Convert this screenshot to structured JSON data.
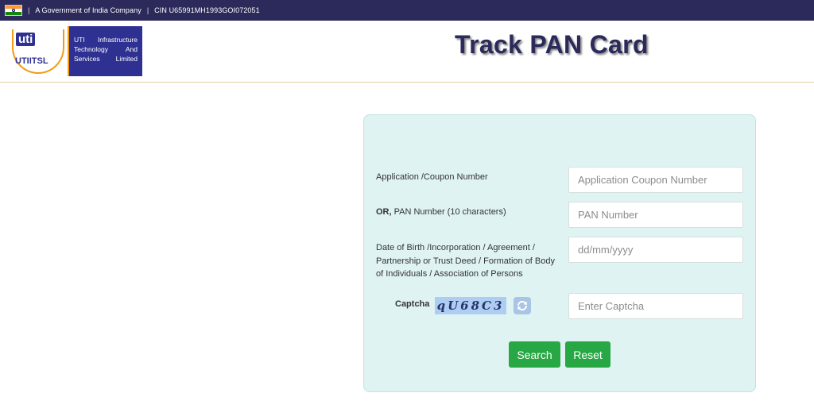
{
  "topbar": {
    "separator": "|",
    "company_note": "A Government of India Company",
    "cin": "CIN U65991MH1993GOI072051"
  },
  "header": {
    "logo": {
      "mark_text": "uti",
      "short_name": "UTIITSL",
      "full_name": "UTI Infrastructure Technology And Services Limited"
    },
    "title": "Track PAN Card"
  },
  "form": {
    "application_label": "Application /Coupon Number",
    "application_placeholder": "Application Coupon Number",
    "or_label": "OR,",
    "pan_label": "PAN Number (10 characters)",
    "pan_placeholder": "PAN Number",
    "dob_label": "Date of Birth /Incorporation / Agreement / Partnership or Trust Deed / Formation of Body of Individuals / Association of Persons",
    "dob_placeholder": "dd/mm/yyyy",
    "captcha_label": "Captcha",
    "captcha_text": "qU68C3",
    "captcha_placeholder": "Enter Captcha",
    "search_label": "Search",
    "reset_label": "Reset"
  },
  "icons": {
    "flag": "india-flag-icon",
    "refresh": "refresh-icon"
  },
  "colors": {
    "topbar": "#2c2a5a",
    "brand": "#2e3192",
    "panel_bg": "#dff3f3",
    "button": "#28a745"
  }
}
